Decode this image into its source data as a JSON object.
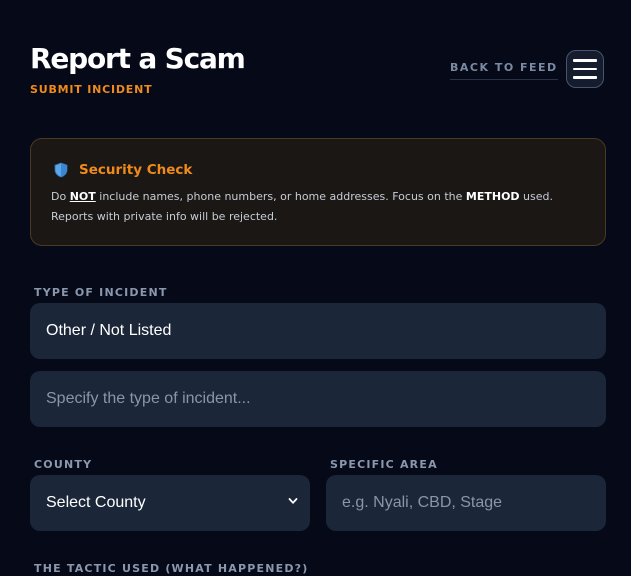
{
  "header": {
    "title": "Report a Scam",
    "subtitle": "SUBMIT INCIDENT",
    "back_link": "BACK TO FEED",
    "menu_icon": "hamburger-icon"
  },
  "security_alert": {
    "icon": "shield-icon",
    "title": "Security Check",
    "body_prefix": "Do ",
    "body_not": "NOT",
    "body_middle": " include names, phone numbers, or home addresses. Focus on the ",
    "body_method": "METHOD",
    "body_suffix": " used. Reports with private info will be rejected."
  },
  "form": {
    "incident_type": {
      "label": "TYPE OF INCIDENT",
      "selected": "Other / Not Listed"
    },
    "incident_other": {
      "placeholder": "Specify the type of incident..."
    },
    "county": {
      "label": "COUNTY",
      "selected": "Select County"
    },
    "specific_area": {
      "label": "SPECIFIC AREA",
      "placeholder": "e.g. Nyali, CBD, Stage"
    },
    "tactic": {
      "label": "THE TACTIC USED (WHAT HAPPENED?)"
    }
  },
  "colors": {
    "background": "#060a18",
    "accent": "#f08a1c",
    "field": "#1b2638",
    "muted": "#8a97ad"
  }
}
